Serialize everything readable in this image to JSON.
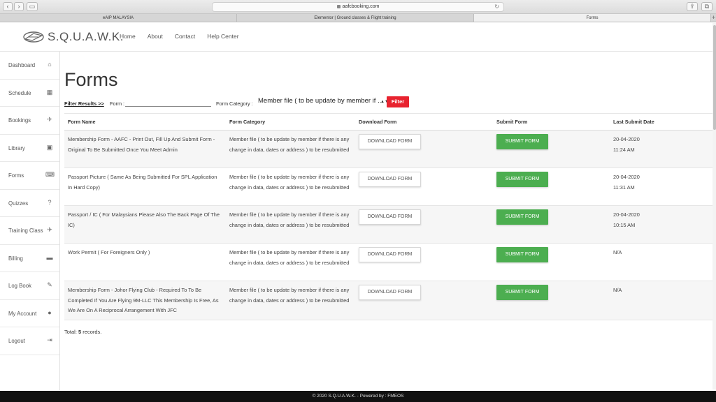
{
  "browser": {
    "url": "aafcbooking.com",
    "tabs": [
      {
        "label": "eAIP MALAYSIA",
        "active": false
      },
      {
        "label": "Elementor | Ground classes & Flight training",
        "active": false
      },
      {
        "label": "Forms",
        "active": true
      }
    ]
  },
  "header": {
    "logo_text": "S.Q.U.A.W.K.",
    "nav": [
      "Home",
      "About",
      "Contact",
      "Help Center"
    ]
  },
  "sidebar": {
    "items": [
      {
        "label": "Dashboard",
        "icon": "home-icon",
        "glyph": "⌂"
      },
      {
        "label": "Schedule",
        "icon": "calendar-icon",
        "glyph": "▦"
      },
      {
        "label": "Bookings",
        "icon": "plane-icon",
        "glyph": "✈"
      },
      {
        "label": "Library",
        "icon": "book-icon",
        "glyph": "▣"
      },
      {
        "label": "Forms",
        "icon": "keyboard-icon",
        "glyph": "⌨"
      },
      {
        "label": "Quizzes",
        "icon": "question-icon",
        "glyph": "?"
      },
      {
        "label": "Training Class",
        "icon": "plane-side-icon",
        "glyph": "✈"
      },
      {
        "label": "Billing",
        "icon": "credit-card-icon",
        "glyph": "▬"
      },
      {
        "label": "Log Book",
        "icon": "logbook-icon",
        "glyph": "✎"
      },
      {
        "label": "My Account",
        "icon": "user-icon",
        "glyph": "●"
      },
      {
        "label": "Logout",
        "icon": "logout-icon",
        "glyph": "⇥"
      }
    ]
  },
  "main": {
    "title": "Forms",
    "filter": {
      "results_label": "Filter Results >>",
      "form_label": "Form :",
      "form_value": "",
      "category_label": "Form Category :",
      "category_value": "Member file ( to be update by member if ...",
      "button": "Filter"
    },
    "table": {
      "headers": [
        "Form Name",
        "Form Category",
        "Download Form",
        "Submit Form",
        "Last Submit Date"
      ],
      "download_label": "DOWNLOAD FORM",
      "submit_label": "SUBMIT FORM",
      "rows": [
        {
          "name": "Membership Form - AAFC - Print Out, Fill Up And Submit Form - Original To Be Submitted Once You Meet Admin",
          "category": "Member file ( to be update by member if there is any change in data, dates or address ) to be resubmitted",
          "date": "20-04-2020",
          "time": "11:24 AM"
        },
        {
          "name": "Passport Picture ( Same As Being Submitted For SPL Application In Hard Copy)",
          "category": "Member file ( to be update by member if there is any change in data, dates or address ) to be resubmitted",
          "date": "20-04-2020",
          "time": "11:31 AM"
        },
        {
          "name": "Passport / IC ( For Malaysians Please Also The Back Page Of The IC)",
          "category": "Member file ( to be update by member if there is any change in data, dates or address ) to be resubmitted",
          "date": "20-04-2020",
          "time": "10:15 AM"
        },
        {
          "name": "Work Permit ( For Foreigners Only )",
          "category": "Member file ( to be update by member if there is any change in data, dates or address ) to be resubmitted",
          "date": "N/A",
          "time": ""
        },
        {
          "name": "Membership Form - Johor Flying Club - Required To To Be Completed If You Are Flying 9M-LLC This Membership Is Free, As We Are On A Reciprocal Arrangement With JFC",
          "category": "Member file ( to be update by member if there is any change in data, dates or address ) to be resubmitted",
          "date": "N/A",
          "time": ""
        }
      ]
    },
    "total_prefix": "Total: ",
    "total_count": "5",
    "total_suffix": " records."
  },
  "footer": {
    "text": "© 2020 S.Q.U.A.W.K.   -   Powered by : FMEOS"
  },
  "colors": {
    "filter_button": "#e8232f",
    "submit_button": "#4cae50",
    "footer_bg": "#111111"
  }
}
